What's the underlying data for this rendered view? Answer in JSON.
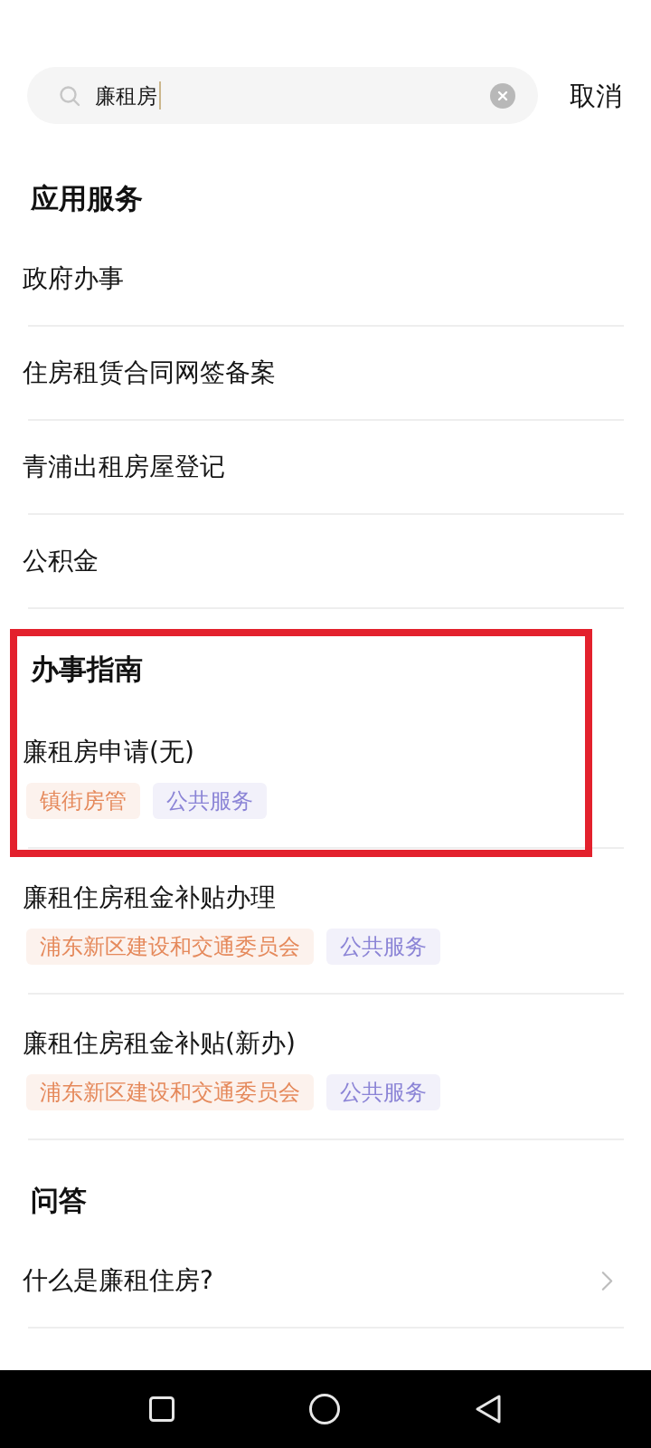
{
  "search": {
    "value": "廉租房",
    "focused": true
  },
  "cancel": "取消",
  "sections": [
    {
      "title": "应用服务",
      "kind": "apps",
      "highlighted": false,
      "items": [
        {
          "title": "政府办事",
          "highlighted": false
        },
        {
          "title": "住房租赁合同网签备案",
          "highlighted": false
        },
        {
          "title": "青浦出租房屋登记",
          "highlighted": false
        },
        {
          "title": "公积金",
          "highlighted": false
        }
      ]
    },
    {
      "title": "办事指南",
      "kind": "guides",
      "highlighted": true,
      "items": [
        {
          "title": "廉租房申请(无)",
          "highlighted": true,
          "tags": [
            {
              "label": "镇街房管",
              "color": "#e5895b"
            },
            {
              "label": "公共服务",
              "color": "#8b84d6"
            }
          ]
        },
        {
          "title": "廉租住房租金补贴办理",
          "highlighted": false,
          "tags": [
            {
              "label": "浦东新区建设和交通委员会",
              "color": "#e5895b"
            },
            {
              "label": "公共服务",
              "color": "#8b84d6"
            }
          ]
        },
        {
          "title": "廉租住房租金补贴(新办)",
          "highlighted": false,
          "tags": [
            {
              "label": "浦东新区建设和交通委员会",
              "color": "#e5895b"
            },
            {
              "label": "公共服务",
              "color": "#8b84d6"
            }
          ]
        }
      ]
    },
    {
      "title": "问答",
      "kind": "qa",
      "highlighted": false,
      "items": [
        {
          "title": "什么是廉租住房?",
          "highlighted": false
        }
      ]
    }
  ]
}
